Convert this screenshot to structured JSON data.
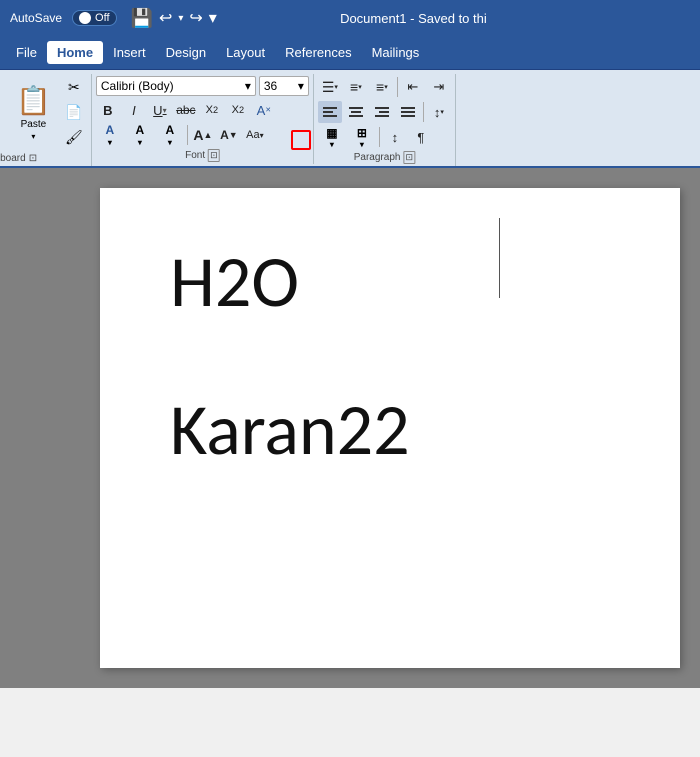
{
  "titlebar": {
    "autosave_label": "AutoSave",
    "toggle_state": "Off",
    "title": "Document1  -  Saved to thi",
    "save_icon": "💾",
    "undo_icon": "↩",
    "redo_icon": "↪",
    "more_icon": "▾"
  },
  "menubar": {
    "items": [
      {
        "label": "File",
        "active": false
      },
      {
        "label": "Home",
        "active": true
      },
      {
        "label": "Insert",
        "active": false
      },
      {
        "label": "Design",
        "active": false
      },
      {
        "label": "Layout",
        "active": false
      },
      {
        "label": "References",
        "active": false
      },
      {
        "label": "Mailings",
        "active": false
      }
    ]
  },
  "ribbon": {
    "clipboard": {
      "label": "Clipboard",
      "paste_label": "Paste",
      "cut_label": "✂",
      "copy_label": "📋",
      "format_label": "🖌"
    },
    "font": {
      "label": "Font",
      "font_name": "Calibri (Body)",
      "font_size": "36",
      "bold": "B",
      "italic": "I",
      "underline": "U",
      "strikethrough": "abc",
      "subscript": "X₂",
      "superscript": "X²",
      "clear_format": "A",
      "font_color_label": "A",
      "font_color": "#ff0000",
      "highlight_color": "#ffff00",
      "text_color": "#ff0000",
      "grow_font": "A↑",
      "shrink_font": "A↓",
      "change_case": "Aa",
      "dialog_launcher": "⤢"
    },
    "paragraph": {
      "label": "Paragraph",
      "bullets_icon": "☰",
      "numbering_icon": "≡",
      "multilevel_icon": "≡",
      "decrease_indent": "⇤",
      "increase_indent": "⇥",
      "align_left": "≡",
      "align_center": "≡",
      "align_right": "≡",
      "justify": "≡",
      "line_spacing": "↕",
      "shading": "▦",
      "borders": "⊞",
      "sort": "↕",
      "show_formatting": "¶",
      "dialog_launcher": "⤢"
    }
  },
  "document": {
    "text1": "H2O",
    "text2": "Karan22"
  }
}
